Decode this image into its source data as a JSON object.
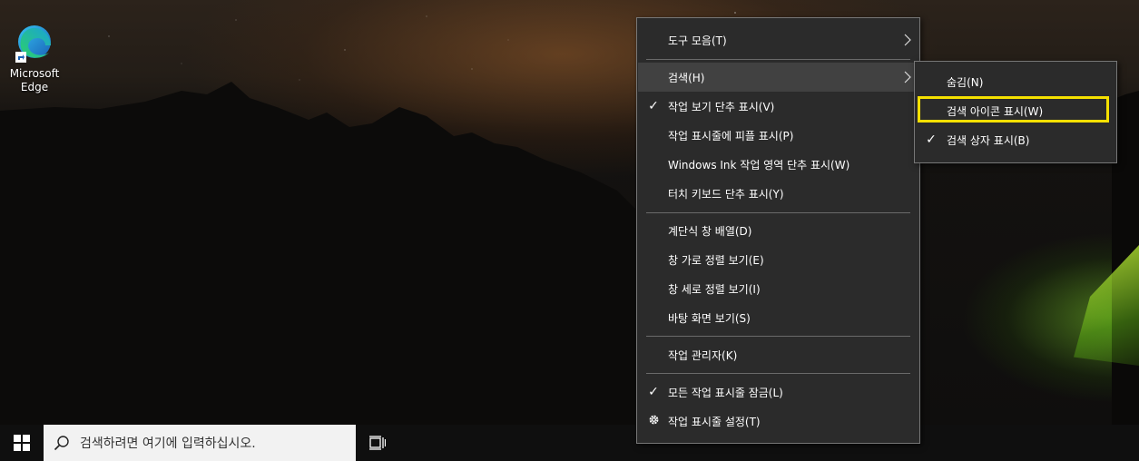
{
  "desktop": {
    "icons": [
      {
        "label": "Microsoft\nEdge",
        "icon": "microsoft-edge-icon"
      }
    ]
  },
  "context_menu": {
    "items": [
      {
        "label": "도구 모음(T)",
        "submenu": true
      },
      {
        "label": "검색(H)",
        "submenu": true,
        "hovered": true
      },
      {
        "label": "작업 보기 단추 표시(V)",
        "checked": true
      },
      {
        "label": "작업 표시줄에 피플 표시(P)"
      },
      {
        "label": "Windows Ink 작업 영역 단추 표시(W)"
      },
      {
        "label": "터치 키보드 단추 표시(Y)"
      },
      {
        "label": "계단식 창 배열(D)"
      },
      {
        "label": "창 가로 정렬 보기(E)"
      },
      {
        "label": "창 세로 정렬 보기(I)"
      },
      {
        "label": "바탕 화면 보기(S)"
      },
      {
        "label": "작업 관리자(K)"
      },
      {
        "label": "모든 작업 표시줄 잠금(L)",
        "checked": true
      },
      {
        "label": "작업 표시줄 설정(T)",
        "icon": "gear-icon"
      }
    ]
  },
  "search_submenu": {
    "items": [
      {
        "label": "숨김(N)"
      },
      {
        "label": "검색 아이콘 표시(W)",
        "highlighted": true
      },
      {
        "label": "검색 상자 표시(B)",
        "checked": true
      }
    ],
    "highlight_color": "#f5e000"
  },
  "taskbar": {
    "search_placeholder": "검색하려면 여기에 입력하십시오.",
    "start_icon": "windows-logo-icon",
    "task_view_icon": "task-view-icon"
  },
  "colors": {
    "menu_bg": "#2b2b2b",
    "menu_hover": "#414141",
    "taskbar_bg": "#0f0f0f"
  }
}
